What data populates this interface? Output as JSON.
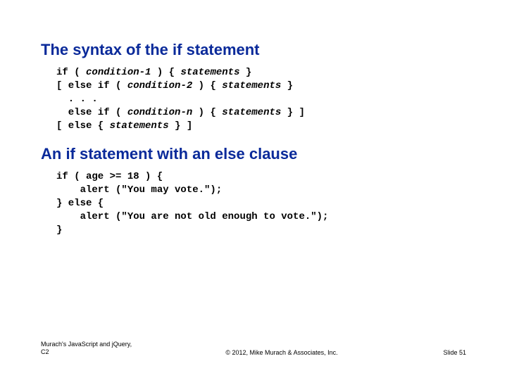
{
  "heading1": "The syntax of the if statement",
  "syntax": {
    "l1a": "if ( ",
    "l1b": "condition-1",
    "l1c": " ) { ",
    "l1d": "statements",
    "l1e": " }",
    "l2a": "[ else if ( ",
    "l2b": "condition-2",
    "l2c": " ) { ",
    "l2d": "statements",
    "l2e": " }",
    "l3": "  . . .",
    "l4a": "  else if ( ",
    "l4b": "condition-n",
    "l4c": " ) { ",
    "l4d": "statements",
    "l4e": " } ]",
    "l5a": "[ else { ",
    "l5b": "statements",
    "l5c": " } ]"
  },
  "heading2": "An if statement with an else clause",
  "example": {
    "l1": "if ( age >= 18 ) {",
    "l2": "    alert (\"You may vote.\");",
    "l3": "} else {",
    "l4": "    alert (\"You are not old enough to vote.\");",
    "l5": "}"
  },
  "footer": {
    "left_line1": "Murach's JavaScript and jQuery,",
    "left_line2": "C2",
    "center": "© 2012, Mike Murach & Associates, Inc.",
    "right": "Slide 51"
  }
}
